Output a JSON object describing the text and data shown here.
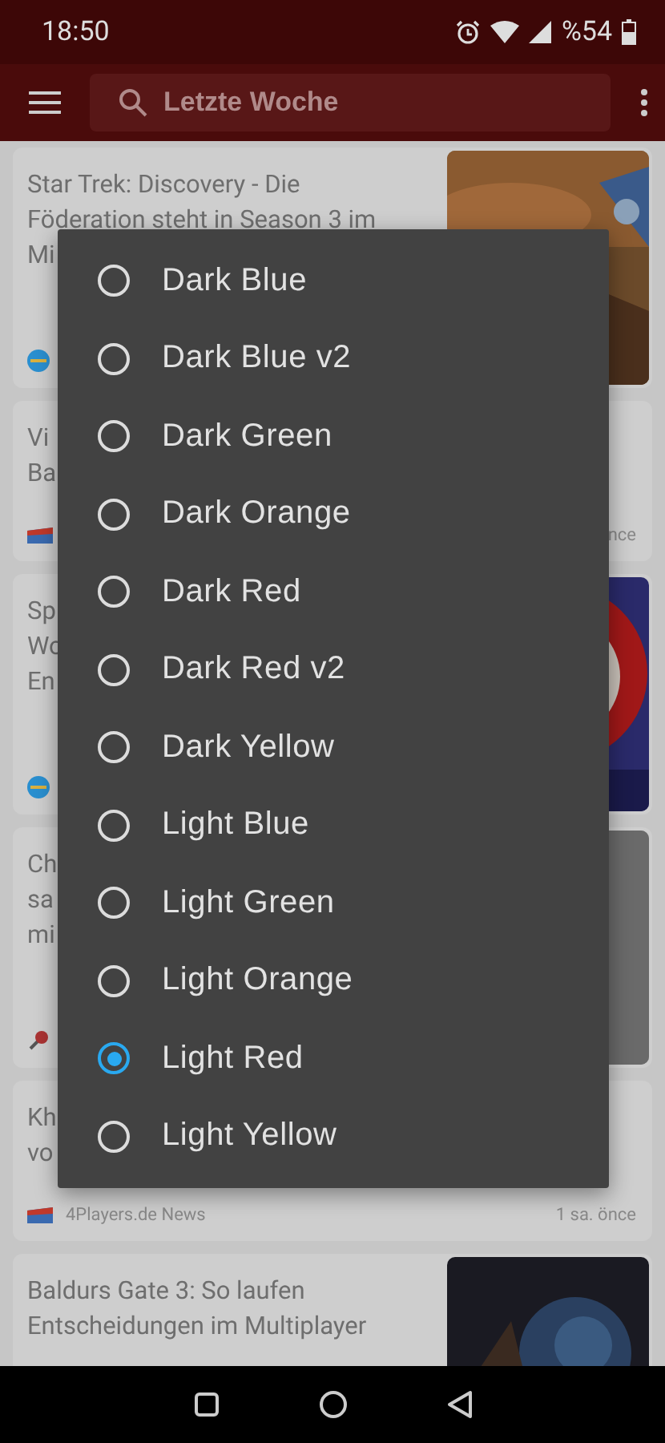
{
  "status_bar": {
    "time": "18:50",
    "battery": "%54"
  },
  "toolbar": {
    "search": {
      "placeholder": "Letzte Woche"
    }
  },
  "cards": [
    {
      "title_lines": [
        "Star Trek: Discovery - Die",
        "Föderation steht in Season 3 im",
        "Mi"
      ],
      "kind": "picture"
    },
    {
      "title_lines": [
        "Vi",
        "Ba"
      ],
      "time": "nce"
    },
    {
      "title_lines": [
        "Sp",
        "Wo",
        "En"
      ],
      "kind": "picture"
    },
    {
      "title_lines": [
        "Ch",
        "sa",
        "mi"
      ],
      "kind": "picture"
    },
    {
      "title_lines": [
        "Kh",
        "vo"
      ],
      "source": "4Players.de News",
      "time": "1 sa. önce"
    },
    {
      "title_lines": [
        "Baldurs Gate 3: So laufen",
        "Entscheidungen im Multiplayer"
      ],
      "kind": "picture"
    }
  ],
  "dialog": {
    "options": [
      {
        "label": "Dark Blue",
        "selected": false
      },
      {
        "label": "Dark Blue v2",
        "selected": false
      },
      {
        "label": "Dark Green",
        "selected": false
      },
      {
        "label": "Dark Orange",
        "selected": false
      },
      {
        "label": "Dark Red",
        "selected": false
      },
      {
        "label": "Dark Red v2",
        "selected": false
      },
      {
        "label": "Dark Yellow",
        "selected": false
      },
      {
        "label": "Light Blue",
        "selected": false
      },
      {
        "label": "Light Green",
        "selected": false
      },
      {
        "label": "Light Orange",
        "selected": false
      },
      {
        "label": "Light Red",
        "selected": true
      },
      {
        "label": "Light Yellow",
        "selected": false
      }
    ]
  }
}
